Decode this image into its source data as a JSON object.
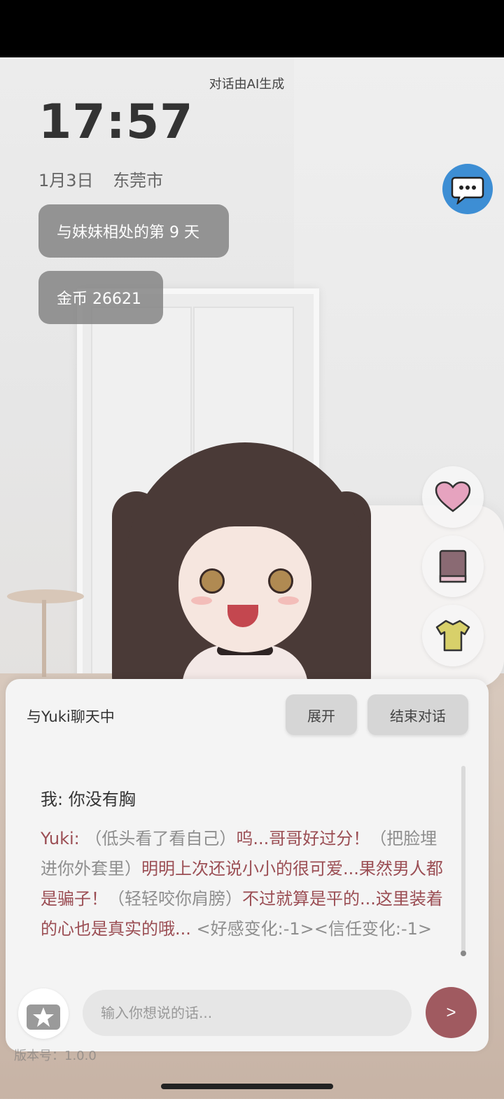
{
  "notice": "对话由AI生成",
  "clock": "17:57",
  "date": {
    "day": "1月3日",
    "city": "东莞市"
  },
  "stats": {
    "days_text": "与妹妹相处的第 9 天",
    "coins_text": "金币 26621"
  },
  "icons": {
    "chat": "chat-bubble-icon",
    "heart": "heart-icon",
    "book": "book-icon",
    "shirt": "shirt-icon",
    "gift": "gift-icon"
  },
  "colors": {
    "accent": "#a05a60",
    "chat_fab": "#3d8ed4",
    "ai_speech": "#9b4e54"
  },
  "chat": {
    "title": "与Yuki聊天中",
    "expand_label": "展开",
    "end_label": "结束对话",
    "user_message": "我: 你没有胸",
    "ai_name": "Yuki:",
    "ai_parts": [
      {
        "type": "action",
        "text": " （低头看了看自己）"
      },
      {
        "type": "speech",
        "text": "呜...哥哥好过分！"
      },
      {
        "type": "action",
        "text": "（把脸埋进你外套里）"
      },
      {
        "type": "speech",
        "text": "明明上次还说小小的很可爱...果然男人都是骗子！"
      },
      {
        "type": "action",
        "text": "（轻轻咬你肩膀）"
      },
      {
        "type": "speech",
        "text": "不过就算是平的...这里装着的心也是真实的哦..."
      },
      {
        "type": "action",
        "text": " <好感变化:-1><信任变化:-1>"
      }
    ],
    "input_placeholder": "输入你想说的话...",
    "send_label": ">",
    "version_text": "版本号：1.0.0"
  }
}
